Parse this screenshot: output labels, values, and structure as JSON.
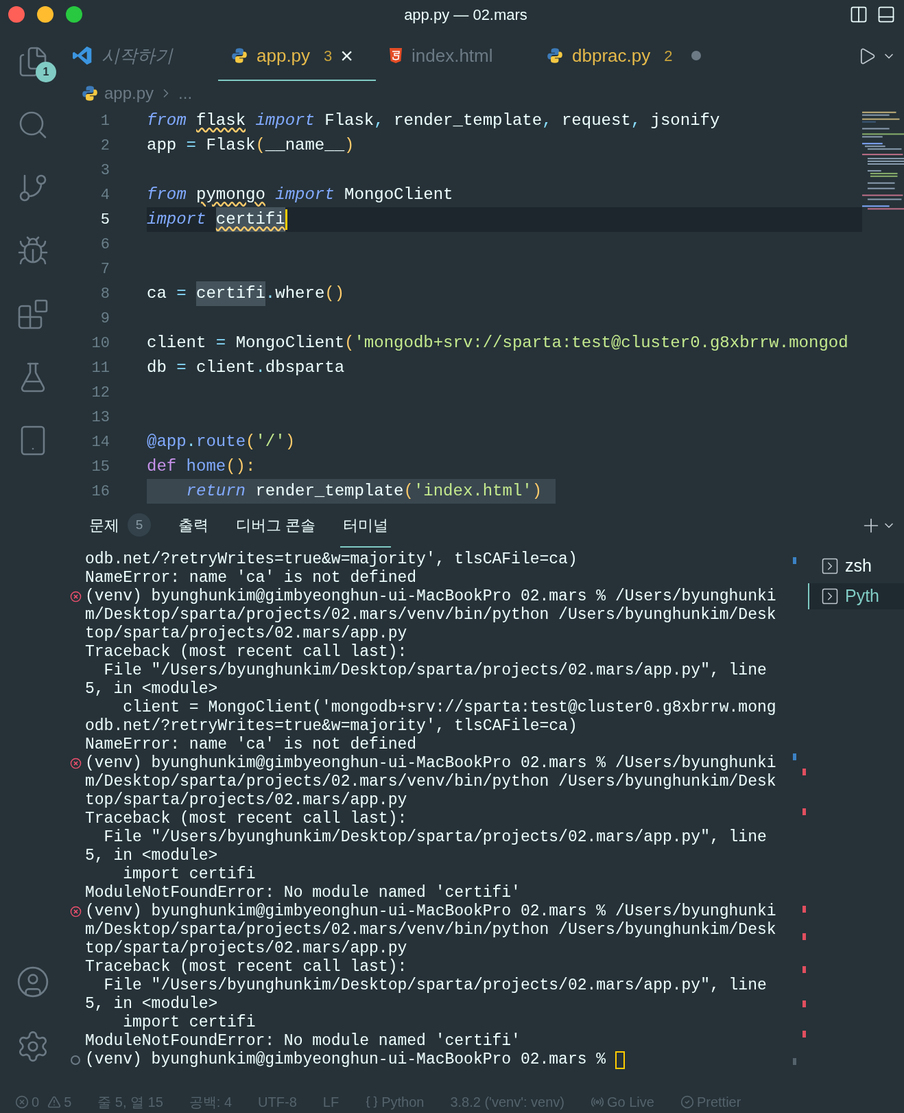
{
  "window": {
    "title": "app.py — 02.mars"
  },
  "activity_bar": {
    "items": [
      {
        "kind": "files",
        "badge": "1",
        "selected": false
      },
      {
        "kind": "search",
        "selected": false
      },
      {
        "kind": "source-control",
        "selected": false
      },
      {
        "kind": "run-debug",
        "selected": false
      },
      {
        "kind": "extensions",
        "selected": false
      },
      {
        "kind": "testing",
        "selected": false
      },
      {
        "kind": "notebook",
        "selected": false
      }
    ],
    "bottom": [
      {
        "kind": "account"
      },
      {
        "kind": "settings"
      }
    ]
  },
  "tabs": [
    {
      "kind": "welcome",
      "label": "시작하기",
      "selected": false,
      "italic": true
    },
    {
      "kind": "python",
      "label": "app.py",
      "count": "3",
      "close": "×",
      "selected": true
    },
    {
      "kind": "html",
      "label": "index.html",
      "selected": false
    },
    {
      "kind": "python",
      "label": "dbprac.py",
      "count": "2",
      "modified": true,
      "selected": false
    }
  ],
  "breadcrumb": {
    "file": "app.py",
    "rest": "..."
  },
  "code": [
    {
      "n": "1",
      "current": false,
      "tokens": [
        {
          "t": "from ",
          "kind": "kw"
        },
        {
          "t": "flask",
          "kind": "id",
          "squiggle": true
        },
        {
          "t": " import",
          "kind": "kw"
        },
        {
          "t": " Flask",
          "kind": "id"
        },
        {
          "t": ",",
          "kind": "op"
        },
        {
          "t": " render_template",
          "kind": "id"
        },
        {
          "t": ",",
          "kind": "op"
        },
        {
          "t": " request",
          "kind": "id"
        },
        {
          "t": ",",
          "kind": "op"
        },
        {
          "t": " jsonify",
          "kind": "id"
        }
      ]
    },
    {
      "n": "2",
      "current": false,
      "tokens": [
        {
          "t": "app ",
          "kind": "id"
        },
        {
          "t": "=",
          "kind": "op"
        },
        {
          "t": " Flask",
          "kind": "id"
        },
        {
          "t": "(",
          "kind": "paren"
        },
        {
          "t": "__name__",
          "kind": "id"
        },
        {
          "t": ")",
          "kind": "paren"
        }
      ]
    },
    {
      "n": "3",
      "current": false
    },
    {
      "n": "4",
      "current": false,
      "tokens": [
        {
          "t": "from ",
          "kind": "kw"
        },
        {
          "t": "pymongo",
          "kind": "id",
          "squiggle": true
        },
        {
          "t": " import",
          "kind": "kw"
        },
        {
          "t": " MongoClient",
          "kind": "id"
        }
      ]
    },
    {
      "n": "5",
      "current": true,
      "tokens": [
        {
          "t": "import ",
          "kind": "kw"
        },
        {
          "t": "certifi",
          "kind": "id",
          "squiggle": true,
          "highlight": true
        }
      ]
    },
    {
      "n": "6",
      "current": false
    },
    {
      "n": "7",
      "current": false
    },
    {
      "n": "8",
      "current": false,
      "tokens": [
        {
          "t": "ca ",
          "kind": "id"
        },
        {
          "t": "= ",
          "kind": "op"
        },
        {
          "t": "certifi",
          "kind": "id",
          "highlight": true
        },
        {
          "t": ".",
          "kind": "op"
        },
        {
          "t": "where",
          "kind": "id"
        },
        {
          "t": "()",
          "kind": "paren"
        }
      ]
    },
    {
      "n": "9",
      "current": false
    },
    {
      "n": "10",
      "current": false,
      "tokens": [
        {
          "t": "client ",
          "kind": "id"
        },
        {
          "t": "=",
          "kind": "op"
        },
        {
          "t": " MongoClient",
          "kind": "id"
        },
        {
          "t": "(",
          "kind": "paren"
        },
        {
          "t": "'mongodb+srv://sparta:test@cluster0.g8xbrrw.mongod",
          "kind": "str"
        }
      ]
    },
    {
      "n": "11",
      "current": false,
      "tokens": [
        {
          "t": "db ",
          "kind": "id"
        },
        {
          "t": "=",
          "kind": "op"
        },
        {
          "t": " client",
          "kind": "id"
        },
        {
          "t": ".",
          "kind": "op"
        },
        {
          "t": "dbsparta",
          "kind": "id"
        }
      ]
    },
    {
      "n": "12",
      "current": false
    },
    {
      "n": "13",
      "current": false
    },
    {
      "n": "14",
      "current": false,
      "tokens": [
        {
          "t": "@app",
          "kind": "fn"
        },
        {
          "t": ".",
          "kind": "op"
        },
        {
          "t": "route",
          "kind": "fn"
        },
        {
          "t": "(",
          "kind": "paren"
        },
        {
          "t": "'/'",
          "kind": "str"
        },
        {
          "t": ")",
          "kind": "paren"
        }
      ]
    },
    {
      "n": "15",
      "current": false,
      "tokens": [
        {
          "t": "def ",
          "kind": "def"
        },
        {
          "t": "home",
          "kind": "fn"
        },
        {
          "t": "():",
          "kind": "paren"
        }
      ]
    },
    {
      "n": "16",
      "current": false,
      "shaded": true,
      "tokens": [
        {
          "t": "    return",
          "kind": "kw"
        },
        {
          "t": " render_template",
          "kind": "id"
        },
        {
          "t": "(",
          "kind": "paren"
        },
        {
          "t": "'index.html'",
          "kind": "str"
        },
        {
          "t": ")",
          "kind": "paren"
        }
      ]
    }
  ],
  "panel": {
    "tabs": [
      {
        "label": "문제",
        "badge": "5",
        "selected": false
      },
      {
        "label": "출력",
        "selected": false
      },
      {
        "label": "디버그 콘솔",
        "selected": false
      },
      {
        "label": "터미널",
        "selected": true
      }
    ],
    "terminals": [
      {
        "label": "zsh",
        "selected": false
      },
      {
        "label": "Pyth",
        "selected": true
      }
    ]
  },
  "terminal": [
    {
      "kind": "output",
      "text": "odb.net/?retryWrites=true&w=majority', tlsCAFile=ca)"
    },
    {
      "kind": "output",
      "text": "NameError: name 'ca' is not defined"
    },
    {
      "kind": "error-command",
      "text": "(venv) byunghunkim@gimbyeonghun-ui-MacBookPro 02.mars % /Users/byunghunki"
    },
    {
      "kind": "output",
      "text": "m/Desktop/sparta/projects/02.mars/venv/bin/python /Users/byunghunkim/Desk"
    },
    {
      "kind": "output",
      "text": "top/sparta/projects/02.mars/app.py"
    },
    {
      "kind": "output",
      "text": "Traceback (most recent call last):"
    },
    {
      "kind": "output",
      "text": "  File \"/Users/byunghunkim/Desktop/sparta/projects/02.mars/app.py\", line"
    },
    {
      "kind": "output",
      "text": "5, in <module>"
    },
    {
      "kind": "output",
      "text": "    client = MongoClient('mongodb+srv://sparta:test@cluster0.g8xbrrw.mong"
    },
    {
      "kind": "output",
      "text": "odb.net/?retryWrites=true&w=majority', tlsCAFile=ca)"
    },
    {
      "kind": "output",
      "text": "NameError: name 'ca' is not defined"
    },
    {
      "kind": "error-command",
      "text": "(venv) byunghunkim@gimbyeonghun-ui-MacBookPro 02.mars % /Users/byunghunki"
    },
    {
      "kind": "output",
      "text": "m/Desktop/sparta/projects/02.mars/venv/bin/python /Users/byunghunkim/Desk"
    },
    {
      "kind": "output",
      "text": "top/sparta/projects/02.mars/app.py"
    },
    {
      "kind": "output",
      "text": "Traceback (most recent call last):"
    },
    {
      "kind": "output",
      "text": "  File \"/Users/byunghunkim/Desktop/sparta/projects/02.mars/app.py\", line"
    },
    {
      "kind": "output",
      "text": "5, in <module>"
    },
    {
      "kind": "output",
      "text": "    import certifi"
    },
    {
      "kind": "output",
      "text": "ModuleNotFoundError: No module named 'certifi'"
    },
    {
      "kind": "error-command",
      "text": "(venv) byunghunkim@gimbyeonghun-ui-MacBookPro 02.mars % /Users/byunghunki"
    },
    {
      "kind": "output",
      "text": "m/Desktop/sparta/projects/02.mars/venv/bin/python /Users/byunghunkim/Desk"
    },
    {
      "kind": "output",
      "text": "top/sparta/projects/02.mars/app.py"
    },
    {
      "kind": "output",
      "text": "Traceback (most recent call last):"
    },
    {
      "kind": "output",
      "text": "  File \"/Users/byunghunkim/Desktop/sparta/projects/02.mars/app.py\", line"
    },
    {
      "kind": "output",
      "text": "5, in <module>"
    },
    {
      "kind": "output",
      "text": "    import certifi"
    },
    {
      "kind": "output",
      "text": "ModuleNotFoundError: No module named 'certifi'"
    },
    {
      "kind": "idle-command",
      "text": "(venv) byunghunkim@gimbyeonghun-ui-MacBookPro 02.mars %",
      "cursor": true
    }
  ],
  "status_bar": [
    {
      "kind": "errors",
      "text": "0"
    },
    {
      "kind": "warnings",
      "text": "5"
    },
    {
      "kind": "plain",
      "text": "줄 5, 열 15"
    },
    {
      "kind": "plain",
      "text": "공백: 4"
    },
    {
      "kind": "plain",
      "text": "UTF-8"
    },
    {
      "kind": "plain",
      "text": "LF"
    },
    {
      "kind": "language",
      "text": "Python"
    },
    {
      "kind": "plain",
      "text": "3.8.2 ('venv': venv)"
    },
    {
      "kind": "live",
      "text": "Go Live"
    },
    {
      "kind": "check",
      "text": "Prettier"
    }
  ]
}
